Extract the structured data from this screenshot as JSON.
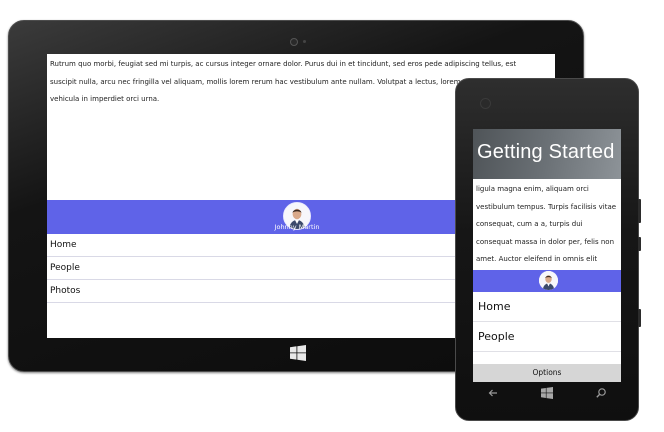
{
  "tablet": {
    "body_text": "Rutrum quo morbi, feugiat sed mi turpis, ac cursus integer ornare dolor. Purus dui in et tincidunt, sed eros pede adipiscing tellus, est suscipit nulla, arcu nec fringilla vel aliquam, mollis lorem rerum hac vestibulum ante nullam. Volutpat a lectus, lorem pulvinar quis. Lobortis vehicula in imperdiet orci urna.",
    "user_name": "Johnny Martin",
    "nav": [
      "Home",
      "People",
      "Photos"
    ]
  },
  "phone": {
    "hero_title": "Getting Started",
    "body_text": "ligula magna enim, aliquam orci vestibulum tempus. Turpis facilisis vitae consequat, cum a a, turpis dui consequat massa in dolor per, felis non amet. Auctor eleifend in omnis elit vestibulum, donec non",
    "nav": [
      "Home",
      "People"
    ],
    "options_label": "Options"
  },
  "colors": {
    "accent": "#5f63e8",
    "device_body": "#141414",
    "app_bar": "#d6d6d6"
  },
  "icons": [
    "windows-logo-icon",
    "back-arrow-icon",
    "windows-start-icon",
    "search-icon",
    "avatar-photo"
  ]
}
